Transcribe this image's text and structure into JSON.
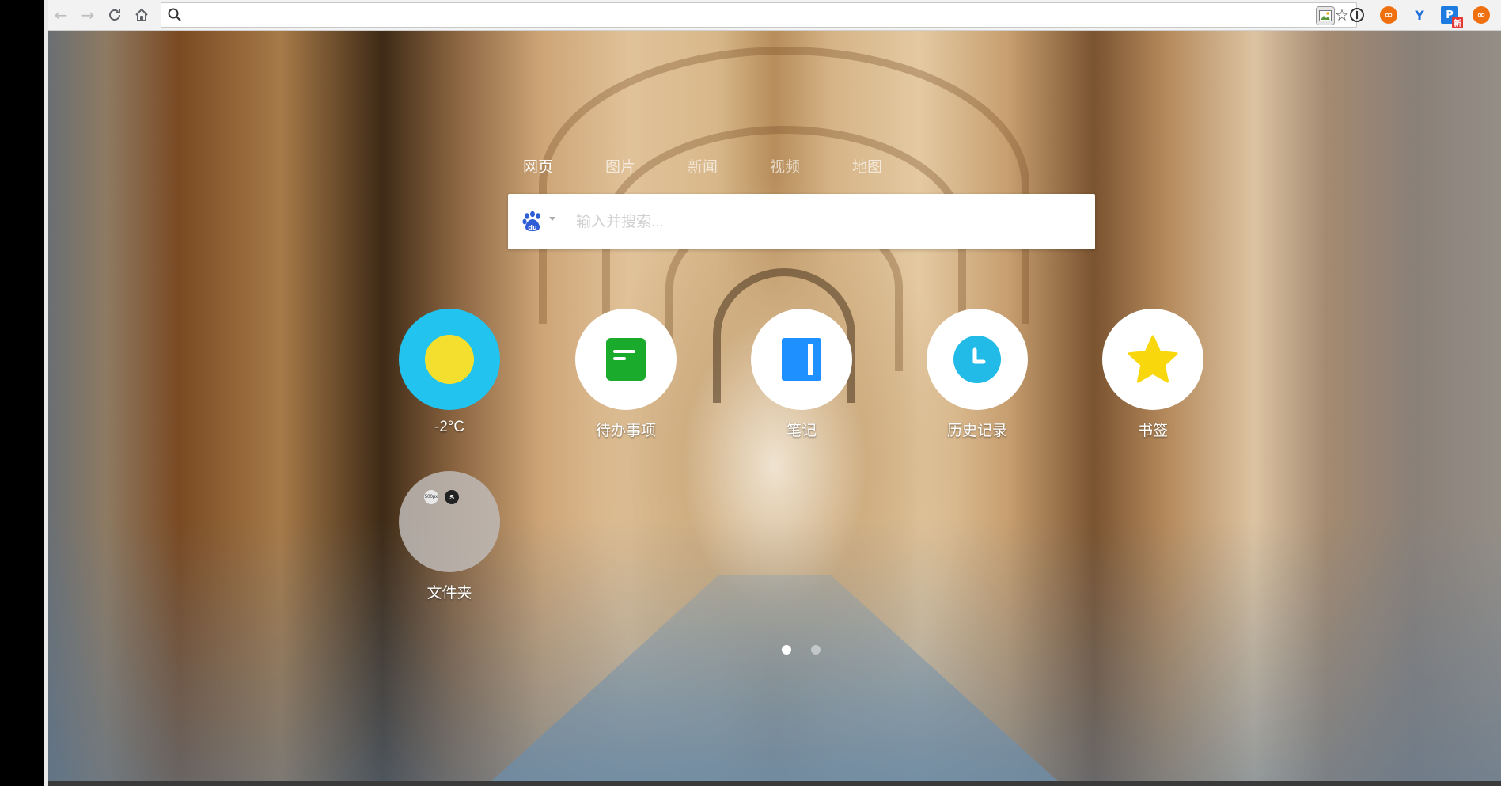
{
  "toolbar": {
    "back_icon": "back-arrow-icon",
    "forward_icon": "forward-arrow-icon",
    "reload_icon": "reload-icon",
    "home_icon": "home-icon",
    "address": "",
    "extensions": [
      {
        "name": "image-extension-icon",
        "color": "#8a8a8a"
      },
      {
        "name": "info-extension-icon",
        "color": "#333333"
      },
      {
        "name": "infinity-extension-icon",
        "color": "#f07010"
      },
      {
        "name": "y-extension-icon",
        "color": "#1e6fd9"
      },
      {
        "name": "p-extension-icon",
        "color": "#1e7be0",
        "badge": "新"
      },
      {
        "name": "infinity-extension-icon-2",
        "color": "#f07010"
      }
    ]
  },
  "search": {
    "tabs": [
      "网页",
      "图片",
      "新闻",
      "视频",
      "地图"
    ],
    "active_tab": "网页",
    "placeholder": "输入并搜索...",
    "engine_icon": "baidu-icon"
  },
  "apps": [
    {
      "label": "-2°C",
      "icon": "weather-sun-icon",
      "circle_color": "#22c3ee"
    },
    {
      "label": "待办事项",
      "icon": "todo-icon",
      "circle_color": "#ffffff",
      "icon_color": "#1aaa2c"
    },
    {
      "label": "笔记",
      "icon": "notes-icon",
      "circle_color": "#ffffff",
      "icon_color": "#1e90ff"
    },
    {
      "label": "历史记录",
      "icon": "history-clock-icon",
      "circle_color": "#ffffff",
      "icon_color": "#22bbe8"
    },
    {
      "label": "书签",
      "icon": "bookmark-star-icon",
      "circle_color": "#ffffff",
      "icon_color": "#f8d80c"
    },
    {
      "label": "文件夹",
      "icon": "folder-icon",
      "circle_color": "#b8b5b2",
      "folder_items": [
        "500px",
        "s"
      ]
    }
  ],
  "pagination": {
    "pages": 2,
    "current": 1
  }
}
